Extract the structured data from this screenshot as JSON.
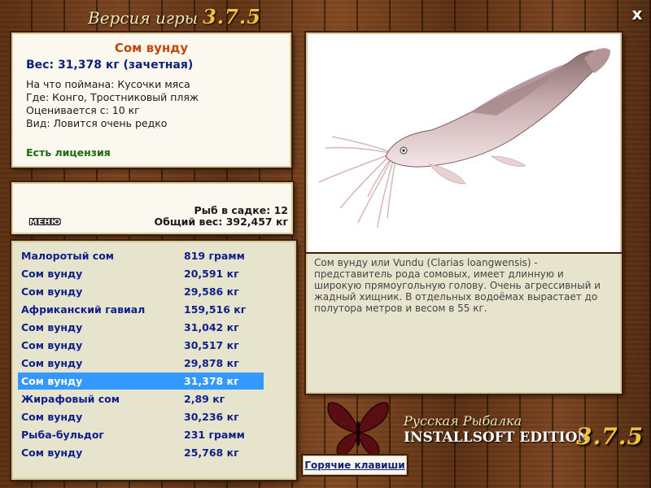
{
  "header": {
    "title": "Версия игры",
    "version": "3.7.5"
  },
  "close_label": "x",
  "fish_info": {
    "name": "Сом вунду",
    "weight": "Вес: 31,378 кг (зачетная)",
    "bait": "На что поймана: Кусочки мяса",
    "location": "Где: Конго, Тростниковый пляж",
    "valued_from": "Оценивается с: 10 кг",
    "rarity": "Вид: Ловится очень редко",
    "license": "Есть лицензия"
  },
  "keepnet": {
    "menu_label": "МЕНЮ",
    "fish_count": "Рыб в садке: 12",
    "total_weight": "Общий вес: 392,457 кг"
  },
  "catch_list": [
    {
      "name": "Малоротый сом",
      "weight": "819 грамм"
    },
    {
      "name": "Сом вунду",
      "weight": "20,591 кг"
    },
    {
      "name": "Сом вунду",
      "weight": "29,586 кг"
    },
    {
      "name": "Африканский гавиал",
      "weight": "159,516 кг"
    },
    {
      "name": "Сом вунду",
      "weight": "31,042 кг"
    },
    {
      "name": "Сом вунду",
      "weight": "30,517 кг"
    },
    {
      "name": "Сом вунду",
      "weight": "29,878 кг"
    },
    {
      "name": "Сом вунду",
      "weight": "31,378 кг"
    },
    {
      "name": "Жирафовый сом",
      "weight": "2,89 кг"
    },
    {
      "name": "Сом вунду",
      "weight": "30,236 кг"
    },
    {
      "name": "Рыба-бульдог",
      "weight": "231 грамм"
    },
    {
      "name": "Сом вунду",
      "weight": "25,768 кг"
    }
  ],
  "selected_index": 7,
  "description": "Сом вунду или Vundu (Clarias loangwensis) - представитель рода сомовых, имеет длинную и широкую прямоугольную голову. Очень агрессивный и жадный хищник. В отдельных водоёмах вырастает до полутора метров и весом в 55 кг.",
  "logo": {
    "line1": "Русская Рыбалка",
    "line2": "INSTALLSOFT EDITION",
    "version": "3.7.5"
  },
  "hotkeys_label": "Горячие клавиши",
  "colors": {
    "selection": "#3399ff",
    "name_orange": "#c0480a",
    "navy": "#10217a",
    "license_green": "#1c6a10",
    "accent_gold": "#f0c040"
  },
  "icons": {
    "fish_picture": "catfish-image",
    "logo": "butterfly-logo-icon"
  }
}
